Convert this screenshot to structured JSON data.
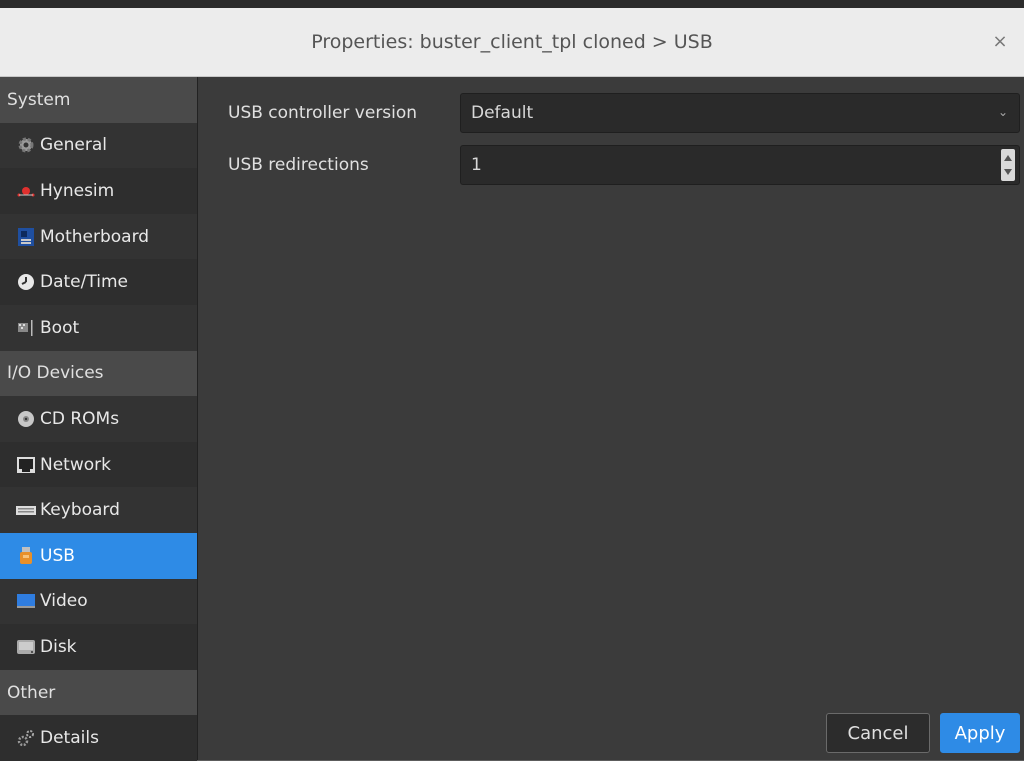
{
  "window": {
    "title": "Properties: buster_client_tpl cloned > USB",
    "close_glyph": "×"
  },
  "sidebar": {
    "sections": [
      {
        "label": "System",
        "items": [
          {
            "label": "General",
            "icon": "gear-icon"
          },
          {
            "label": "Hynesim",
            "icon": "hynesim-icon"
          },
          {
            "label": "Motherboard",
            "icon": "motherboard-icon"
          },
          {
            "label": "Date/Time",
            "icon": "clock-icon"
          },
          {
            "label": "Boot",
            "icon": "boot-icon"
          }
        ]
      },
      {
        "label": "I/O Devices",
        "items": [
          {
            "label": "CD ROMs",
            "icon": "cdrom-icon"
          },
          {
            "label": "Network",
            "icon": "network-icon"
          },
          {
            "label": "Keyboard",
            "icon": "keyboard-icon"
          },
          {
            "label": "USB",
            "icon": "usb-icon",
            "selected": true
          },
          {
            "label": "Video",
            "icon": "monitor-icon"
          },
          {
            "label": "Disk",
            "icon": "disk-icon"
          }
        ]
      },
      {
        "label": "Other",
        "items": [
          {
            "label": "Details",
            "icon": "details-icon"
          }
        ]
      }
    ]
  },
  "main": {
    "usb_controller": {
      "label": "USB controller version",
      "value": "Default"
    },
    "usb_redirections": {
      "label": "USB redirections",
      "value": "1"
    }
  },
  "buttons": {
    "cancel": "Cancel",
    "apply": "Apply"
  },
  "colors": {
    "accent": "#2e8be6",
    "background": "#3b3b3b",
    "sidebar": "#333333"
  }
}
